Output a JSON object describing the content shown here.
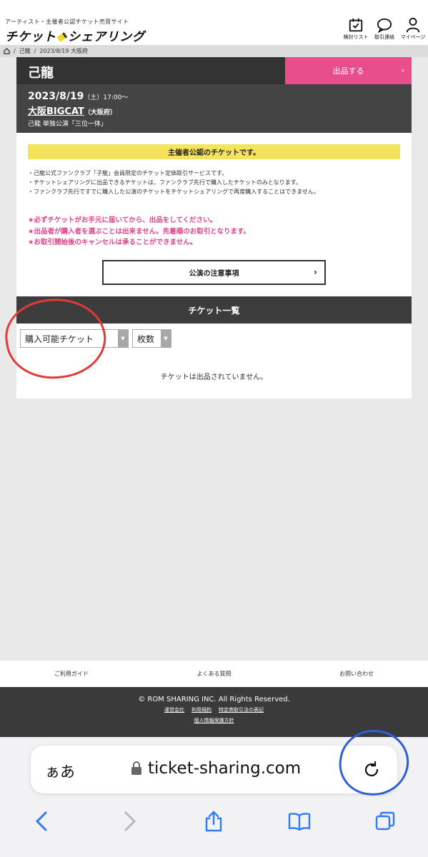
{
  "header": {
    "tagline": "アーティスト・主催者公認チケット売買サイト",
    "logo_left": "チケット",
    "logo_right": "シェアリング",
    "icons": [
      {
        "name": "favorites-icon",
        "label": "検討リスト"
      },
      {
        "name": "messages-icon",
        "label": "取引連絡"
      },
      {
        "name": "mypage-icon",
        "label": "マイページ"
      }
    ]
  },
  "breadcrumb": {
    "items": [
      "己龍",
      "2023/8/19 大阪府"
    ]
  },
  "event": {
    "artist": "己龍",
    "sell_label": "出品する",
    "date": "2023/8/19",
    "weekday": "（土）17:00～",
    "venue": "大阪BIGCAT",
    "venue_pref": "（大阪府）",
    "title": "己龍 単独公演「三位一体」"
  },
  "notice": {
    "banner": "主催者公認のチケットです。",
    "notes": [
      "・己龍公式ファンクラブ「子龍」会員限定のチケット定価取引サービスです。",
      "・チケットシェアリングに出品できるチケットは、ファンクラブ先行で購入したチケットのみとなります。",
      "・ファンクラブ先行ですでに購入した公演のチケットをチケットシェアリングで再度購入することはできません。"
    ],
    "warnings": [
      "★必ずチケットがお手元に届いてから、出品をしてください。",
      "★出品者が購入者を選ぶことは出来ません。先着順のお取引となります。",
      "★お取引開始後のキャンセルは承ることができません。"
    ],
    "button": "公演の注意事項"
  },
  "ticket_list": {
    "title": "チケット一覧",
    "filter_type": "購入可能チケット",
    "filter_count": "枚数",
    "empty": "チケットは出品されていません。"
  },
  "footer": {
    "links": [
      "ご利用ガイド",
      "よくある質問",
      "お問い合わせ"
    ],
    "copyright": "© ROM SHARING INC. All Rights Reserved.",
    "legal": [
      "運営会社",
      "利用規約",
      "特定商取引法の表記"
    ],
    "privacy": "個人情報保護方針"
  },
  "browser": {
    "aa": "ぁあ",
    "url": "ticket-sharing.com"
  },
  "colors": {
    "accent_pink": "#e84f8a",
    "banner_yellow": "#f5e35c",
    "dark_bar": "#333333",
    "annotation_red": "#e33a36",
    "annotation_blue": "#2c5fd8"
  }
}
